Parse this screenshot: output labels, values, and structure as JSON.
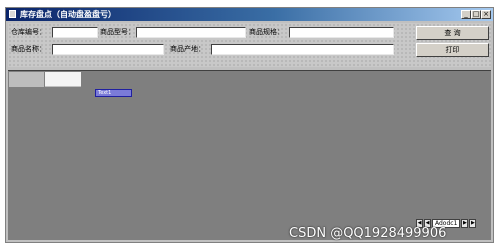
{
  "window": {
    "title": "库存盘点（自动盘盈盘亏）",
    "controls": [
      "_",
      "□",
      "×"
    ]
  },
  "form": {
    "warehouse_no_label": "仓库编号：",
    "product_no_label": "商品型号：",
    "product_spec_label": "商品规格：",
    "product_name_label": "商品名称：",
    "product_origin_label": "商品产地：",
    "warehouse_no_value": "",
    "product_no_value": "",
    "product_spec_value": "",
    "product_name_value": "",
    "product_origin_value": ""
  },
  "buttons": {
    "query": "查  询",
    "print": "打印"
  },
  "grid": {
    "text_box": "Text1"
  },
  "navigator": {
    "first": "◀",
    "prev": "◀",
    "label": "Adodc1",
    "next": "▶",
    "last": "▶"
  },
  "watermark": "CSDN @QQ1928499906"
}
